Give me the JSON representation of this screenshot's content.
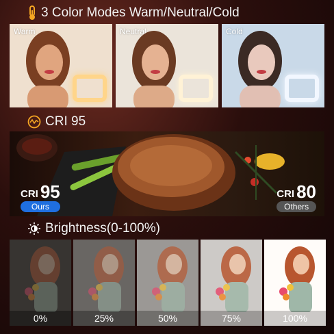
{
  "color_modes": {
    "title": "3 Color Modes Warm/Neutral/Cold",
    "panels": [
      {
        "label": "Warm",
        "bg": "#efe0cf",
        "ring": "#ffd58a"
      },
      {
        "label": "Neutral",
        "bg": "#ebe4da",
        "ring": "#fff2d6"
      },
      {
        "label": "Cold",
        "bg": "#c9d9e8",
        "ring": "#f2f7ff"
      }
    ]
  },
  "cri": {
    "title": "CRI 95",
    "ours": {
      "key": "CRI",
      "value": "95",
      "tag": "Ours",
      "tag_color": "#1f6fe0"
    },
    "others": {
      "key": "CRI",
      "value": "80",
      "tag": "Others",
      "tag_color": "#555555"
    }
  },
  "brightness": {
    "title": "Brightness(0-100%)",
    "levels": [
      {
        "label": "0%",
        "level": 0.0
      },
      {
        "label": "25%",
        "level": 0.25
      },
      {
        "label": "50%",
        "level": 0.5
      },
      {
        "label": "75%",
        "level": 0.75
      },
      {
        "label": "100%",
        "level": 1.0
      }
    ]
  }
}
